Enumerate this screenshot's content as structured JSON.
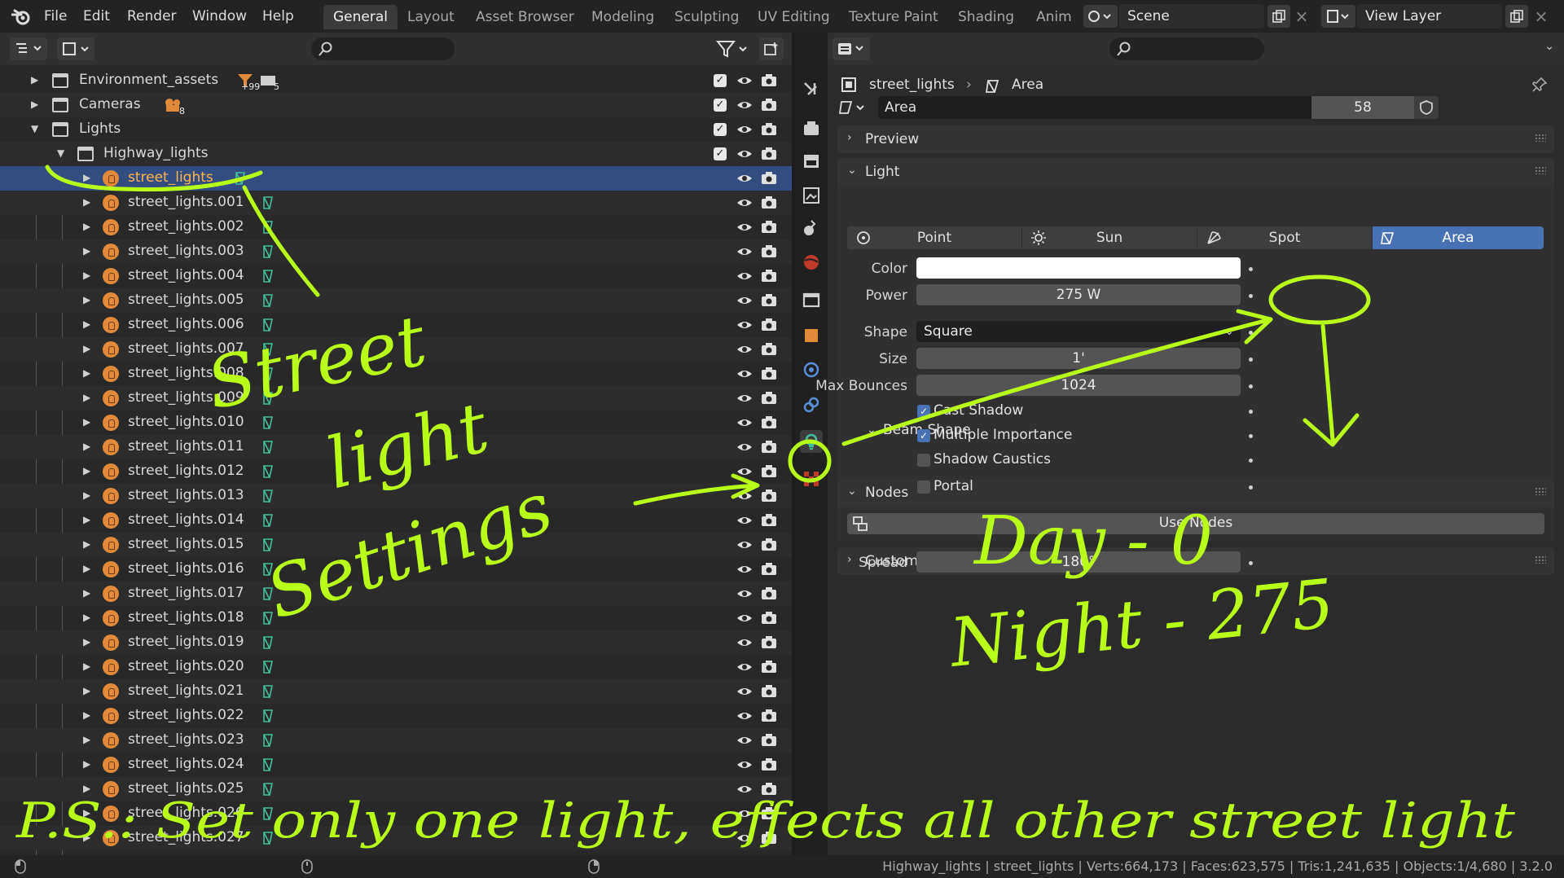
{
  "menu": [
    "File",
    "Edit",
    "Render",
    "Window",
    "Help"
  ],
  "workspaces": [
    "General",
    "Layout",
    "Asset Browser",
    "Modeling",
    "Sculpting",
    "UV Editing",
    "Texture Paint",
    "Shading",
    "Anim"
  ],
  "active_workspace": "General",
  "scene": "Scene",
  "view_layer": "View Layer",
  "outliner": {
    "collections": [
      {
        "name": "Environment_assets",
        "badge1": "+99",
        "badge2": "5"
      },
      {
        "name": "Cameras",
        "badge1": "8"
      },
      {
        "name": "Lights"
      },
      {
        "name": "Highway_lights"
      }
    ],
    "lights": [
      "street_lights",
      "street_lights.001",
      "street_lights.002",
      "street_lights.003",
      "street_lights.004",
      "street_lights.005",
      "street_lights.006",
      "street_lights.007",
      "street_lights.008",
      "street_lights.009",
      "street_lights.010",
      "street_lights.011",
      "street_lights.012",
      "street_lights.013",
      "street_lights.014",
      "street_lights.015",
      "street_lights.016",
      "street_lights.017",
      "street_lights.018",
      "street_lights.019",
      "street_lights.020",
      "street_lights.021",
      "street_lights.022",
      "street_lights.023",
      "street_lights.024",
      "street_lights.025",
      "street_lights.026",
      "street_lights.027"
    ],
    "selected": "street_lights"
  },
  "properties": {
    "breadcrumb_object": "street_lights",
    "breadcrumb_data": "Area",
    "datablock_name": "Area",
    "datablock_users": "58",
    "panels": {
      "preview": "Preview",
      "light": "Light",
      "beam_shape": "Beam Shape",
      "nodes": "Nodes",
      "custom": "Custom Properties"
    },
    "light_types": [
      "Point",
      "Sun",
      "Spot",
      "Area"
    ],
    "active_light_type": "Area",
    "labels": {
      "color": "Color",
      "power": "Power",
      "shape": "Shape",
      "size": "Size",
      "max_bounces": "Max Bounces",
      "spread": "Spread"
    },
    "color_value": "#ffffff",
    "power": "275 W",
    "shape": "Square",
    "size": "1'",
    "max_bounces": "1024",
    "spread": "180°",
    "checkboxes": [
      {
        "label": "Cast Shadow",
        "checked": true
      },
      {
        "label": "Multiple Importance",
        "checked": true
      },
      {
        "label": "Shadow Caustics",
        "checked": false
      },
      {
        "label": "Portal",
        "checked": false
      }
    ],
    "use_nodes": "Use Nodes"
  },
  "status": "Highway_lights | street_lights | Verts:664,173 | Faces:623,575 | Tris:1,241,635 | Objects:1/4,680 | 3.2.0",
  "annotations": {
    "word1": "Street",
    "word2": "light",
    "word3": "Settings",
    "day": "Day - 0",
    "night": "Night - 275",
    "footer": "P.S.: Set only one light, effects all other street light"
  },
  "colors": {
    "accent": "#4772b3",
    "selection": "#334d80",
    "ink": "#b8ff1a",
    "light_icon": "#e08a3a",
    "data_icon": "#3fbf9a"
  }
}
